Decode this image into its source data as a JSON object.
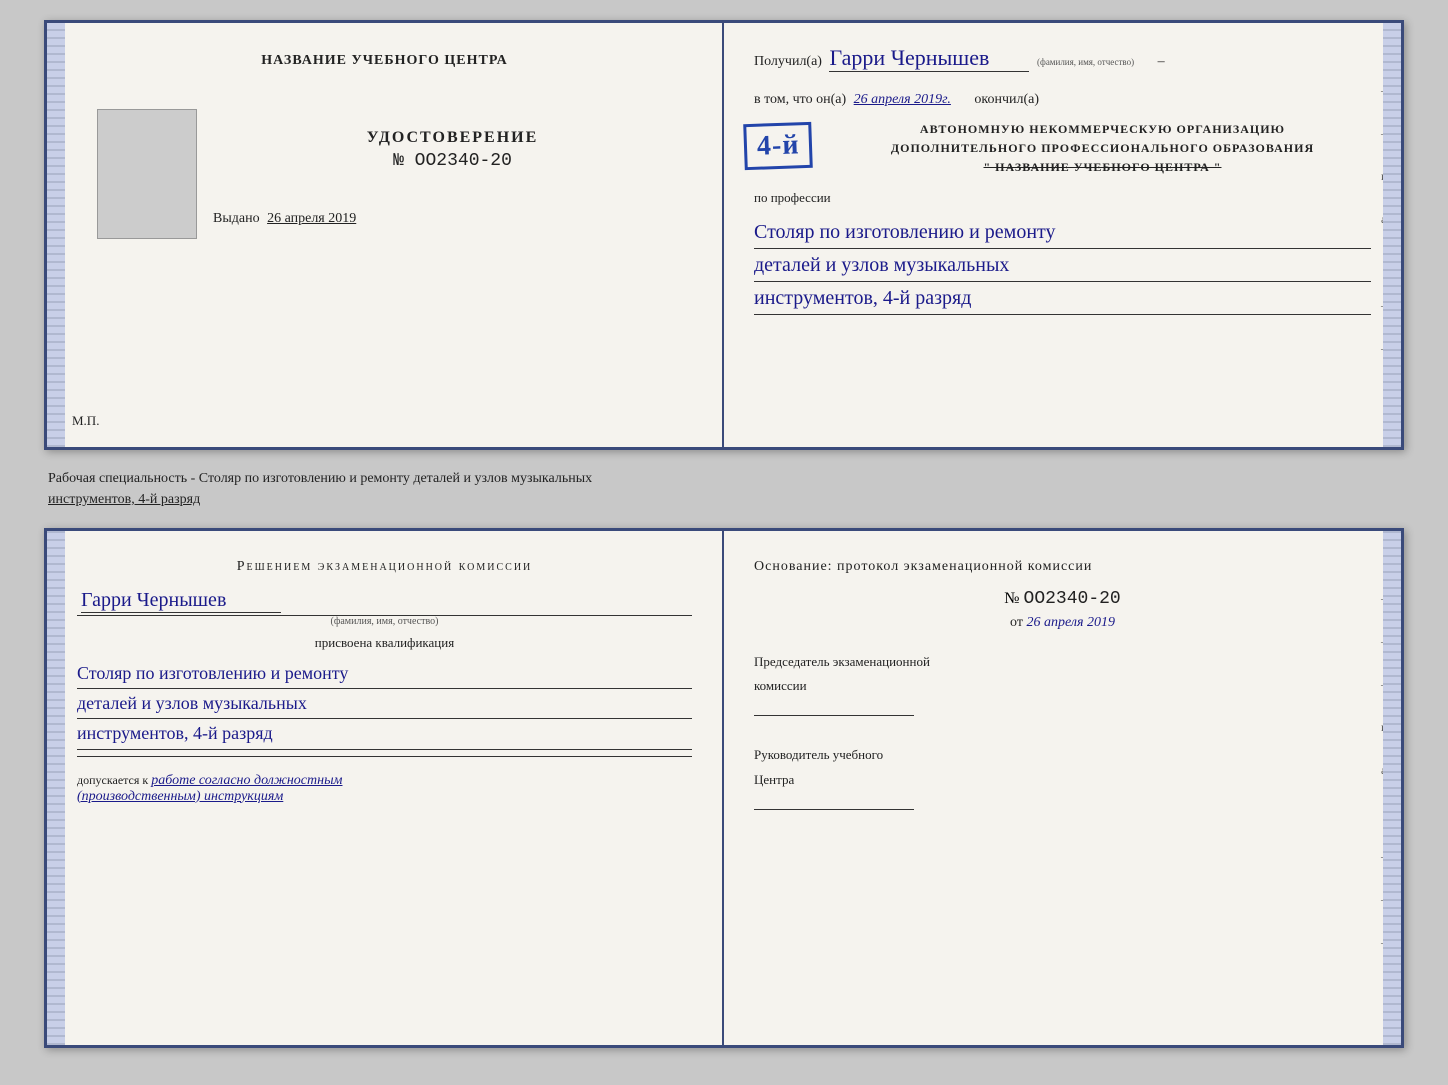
{
  "top_spread": {
    "left": {
      "title": "НАЗВАНИЕ УЧЕБНОГО ЦЕНТРА",
      "cert_label": "УДОСТОВЕРЕНИЕ",
      "cert_number": "№ OO2340-20",
      "issued_label": "Выдано",
      "issued_date": "26 апреля 2019",
      "mp_label": "М.П."
    },
    "right": {
      "received_label": "Получил(а)",
      "received_name": "Гарри Чернышев",
      "fio_sub": "(фамилия, имя, отчество)",
      "in_that_label": "в том, что он(а)",
      "date_value": "26 апреля 2019г.",
      "finished_label": "окончил(а)",
      "stamp_large": "4-й",
      "stamp_line1": "АВТОНОМНУЮ НЕКОММЕРЧЕСКУЮ ОРГАНИЗАЦИЮ",
      "stamp_line2": "ДОПОЛНИТЕЛЬНОГО ПРОФЕССИОНАЛЬНОГО ОБРАЗОВАНИЯ",
      "stamp_line3": "\" НАЗВАНИЕ УЧЕБНОГО ЦЕНТРА \"",
      "profession_label": "по профессии",
      "profession_line1": "Столяр по изготовлению и ремонту",
      "profession_line2": "деталей и узлов музыкальных",
      "profession_line3": "инструментов, 4-й разряд",
      "markers": [
        "–",
        "–",
        "и",
        "а",
        "←",
        "–",
        "–",
        "–"
      ]
    }
  },
  "caption": {
    "text": "Рабочая специальность - Столяр по изготовлению и ремонту деталей и узлов музыкальных",
    "text2": "инструментов, 4-й разряд"
  },
  "lower_spread": {
    "left": {
      "decision_title": "Решением  экзаменационной  комиссии",
      "name": "Гарри Чернышев",
      "fio_sub": "(фамилия, имя, отчество)",
      "assigned_label": "присвоена квалификация",
      "qualification_line1": "Столяр по изготовлению и ремонту",
      "qualification_line2": "деталей и узлов музыкальных",
      "qualification_line3": "инструментов, 4-й разряд",
      "allowed_prefix": "допускается к",
      "allowed_text": "работе согласно должностным",
      "allowed_text2": "(производственным) инструкциям"
    },
    "right": {
      "basis_label": "Основание: протокол экзаменационной  комиссии",
      "number_label": "№",
      "number_value": "OO2340-20",
      "date_prefix": "от",
      "date_value": "26 апреля 2019",
      "chairman_label": "Председатель экзаменационной",
      "chairman_label2": "комиссии",
      "director_label": "Руководитель учебного",
      "director_label2": "Центра",
      "markers": [
        "–",
        "–",
        "–",
        "и",
        "а",
        "←",
        "–",
        "–",
        "–"
      ]
    }
  }
}
